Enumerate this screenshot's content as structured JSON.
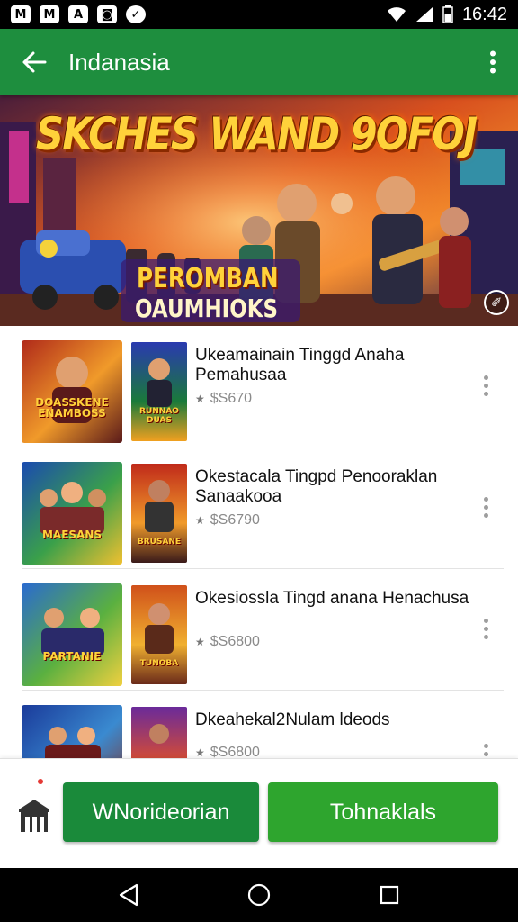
{
  "status_bar": {
    "time": "16:42",
    "notifications": [
      "M",
      "M",
      "A",
      "◙",
      "✓"
    ]
  },
  "app_bar": {
    "title": "Indanasia"
  },
  "banner": {
    "title": "SKCHES WAND 9OFOJ",
    "subtitle_line1": "PEROMBAN",
    "subtitle_line2": "OAUMHIOKS",
    "badge": "✐"
  },
  "list": {
    "items": [
      {
        "title": "Ukeamainain Tinggd Anaha Pemahusaa",
        "price": "$S670",
        "thumb1_text": "DOASSKENE ENAMBOSS",
        "thumb2_text": "RUNNAO DUAS"
      },
      {
        "title": "Okestacala Tingpd Penooraklan Sanaakooa",
        "price": "$S6790",
        "thumb1_text": "MAESANS",
        "thumb2_text": "BRUSANE"
      },
      {
        "title": "Okesiossla Tingd anana Henachusa",
        "price": "$S6800",
        "thumb1_text": "PARTANIE",
        "thumb2_text": "TUNOBA"
      },
      {
        "title": "Dkeahekal2Nulam ldeods",
        "price": "$S6800",
        "thumb1_text": "",
        "thumb2_text": ""
      }
    ]
  },
  "actions": {
    "primary_label": "WNorideorian",
    "secondary_label": "Tohnaklals"
  },
  "colors": {
    "app_bar": "#1e8e3e",
    "primary_button": "#1a8a3a",
    "secondary_button": "#2ea52e"
  },
  "icons": {
    "back": "arrow-left-icon",
    "more": "more-vert-icon",
    "home": "store-icon",
    "nav_back": "triangle-back-icon",
    "nav_home": "circle-home-icon",
    "nav_recents": "square-recents-icon"
  }
}
